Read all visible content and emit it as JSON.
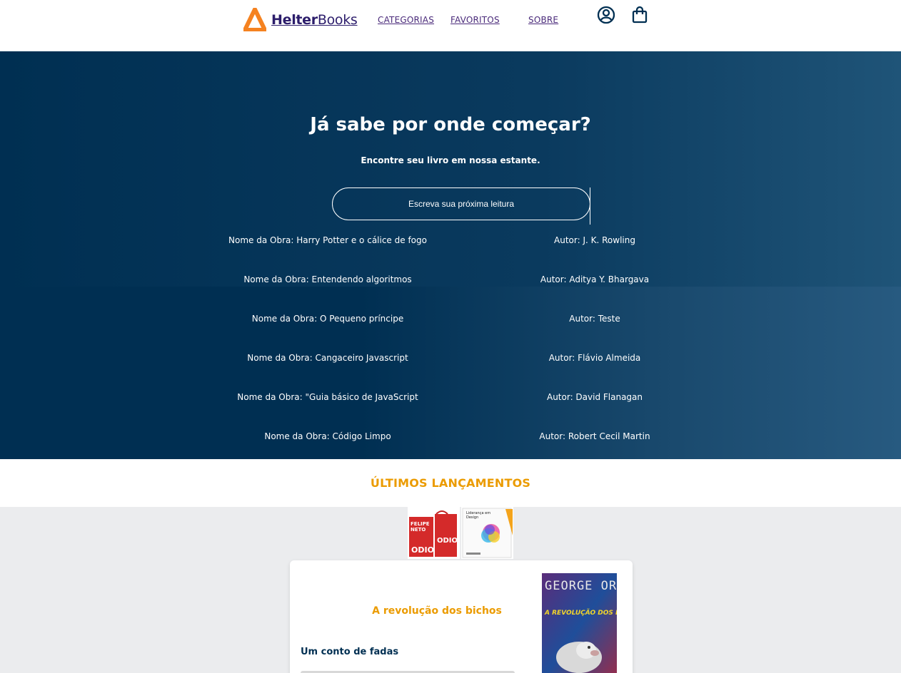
{
  "header": {
    "brand_bold": "Helter",
    "brand_light": "Books",
    "nav": [
      "CATEGORIAS",
      "FAVORITOS",
      "SOBRE"
    ],
    "icons": [
      "user-icon",
      "shopping-bag-icon"
    ],
    "colors": {
      "logo": "#f58220",
      "brand": "#2c1d6b",
      "nav": "#4a2a7a"
    }
  },
  "hero": {
    "title": "Já sabe por onde começar?",
    "subtitle": "Encontre seu livro em nossa estante.",
    "search_placeholder": "Escreva sua próxima leitura",
    "results": [
      {
        "title": "Nome da Obra: Harry Potter e o cálice de fogo",
        "author": "Autor: J. K. Rowling"
      },
      {
        "title": "Nome da Obra: Entendendo algoritmos",
        "author": "Autor: Aditya Y. Bhargava"
      },
      {
        "title": "Nome da Obra: O Pequeno príncipe",
        "author": "Autor: Teste"
      },
      {
        "title": "Nome da Obra: Cangaceiro Javascript",
        "author": "Autor: Flávio Almeida"
      },
      {
        "title": "Nome da Obra: \"Guia básico de JavaScript",
        "author": "Autor: David Flanagan"
      },
      {
        "title": "Nome da Obra: Código Limpo",
        "author": "Autor: Robert Cecil Martin"
      }
    ],
    "colors": {
      "background": "#002f52",
      "text": "#ffffff"
    }
  },
  "releases": {
    "title": "ÚLTIMOS LANÇAMENTOS",
    "thumbnails": [
      {
        "name": "odio-book-thumb",
        "cover_text": [
          "FELIPE",
          "NETO",
          "ODIO",
          "ODIO"
        ]
      },
      {
        "name": "leadership-book-thumb",
        "cover_text": [
          "Liderança em",
          "Design"
        ]
      }
    ],
    "featured": {
      "title": "A revolução dos bichos",
      "subtitle": "Um conto de fadas",
      "cover_author": "GEORGE ORWELL",
      "cover_title": "A REVOLUÇÃO DOS BICHOS"
    },
    "colors": {
      "accent": "#eb9b00",
      "gallery_bg": "#ebecee"
    }
  }
}
